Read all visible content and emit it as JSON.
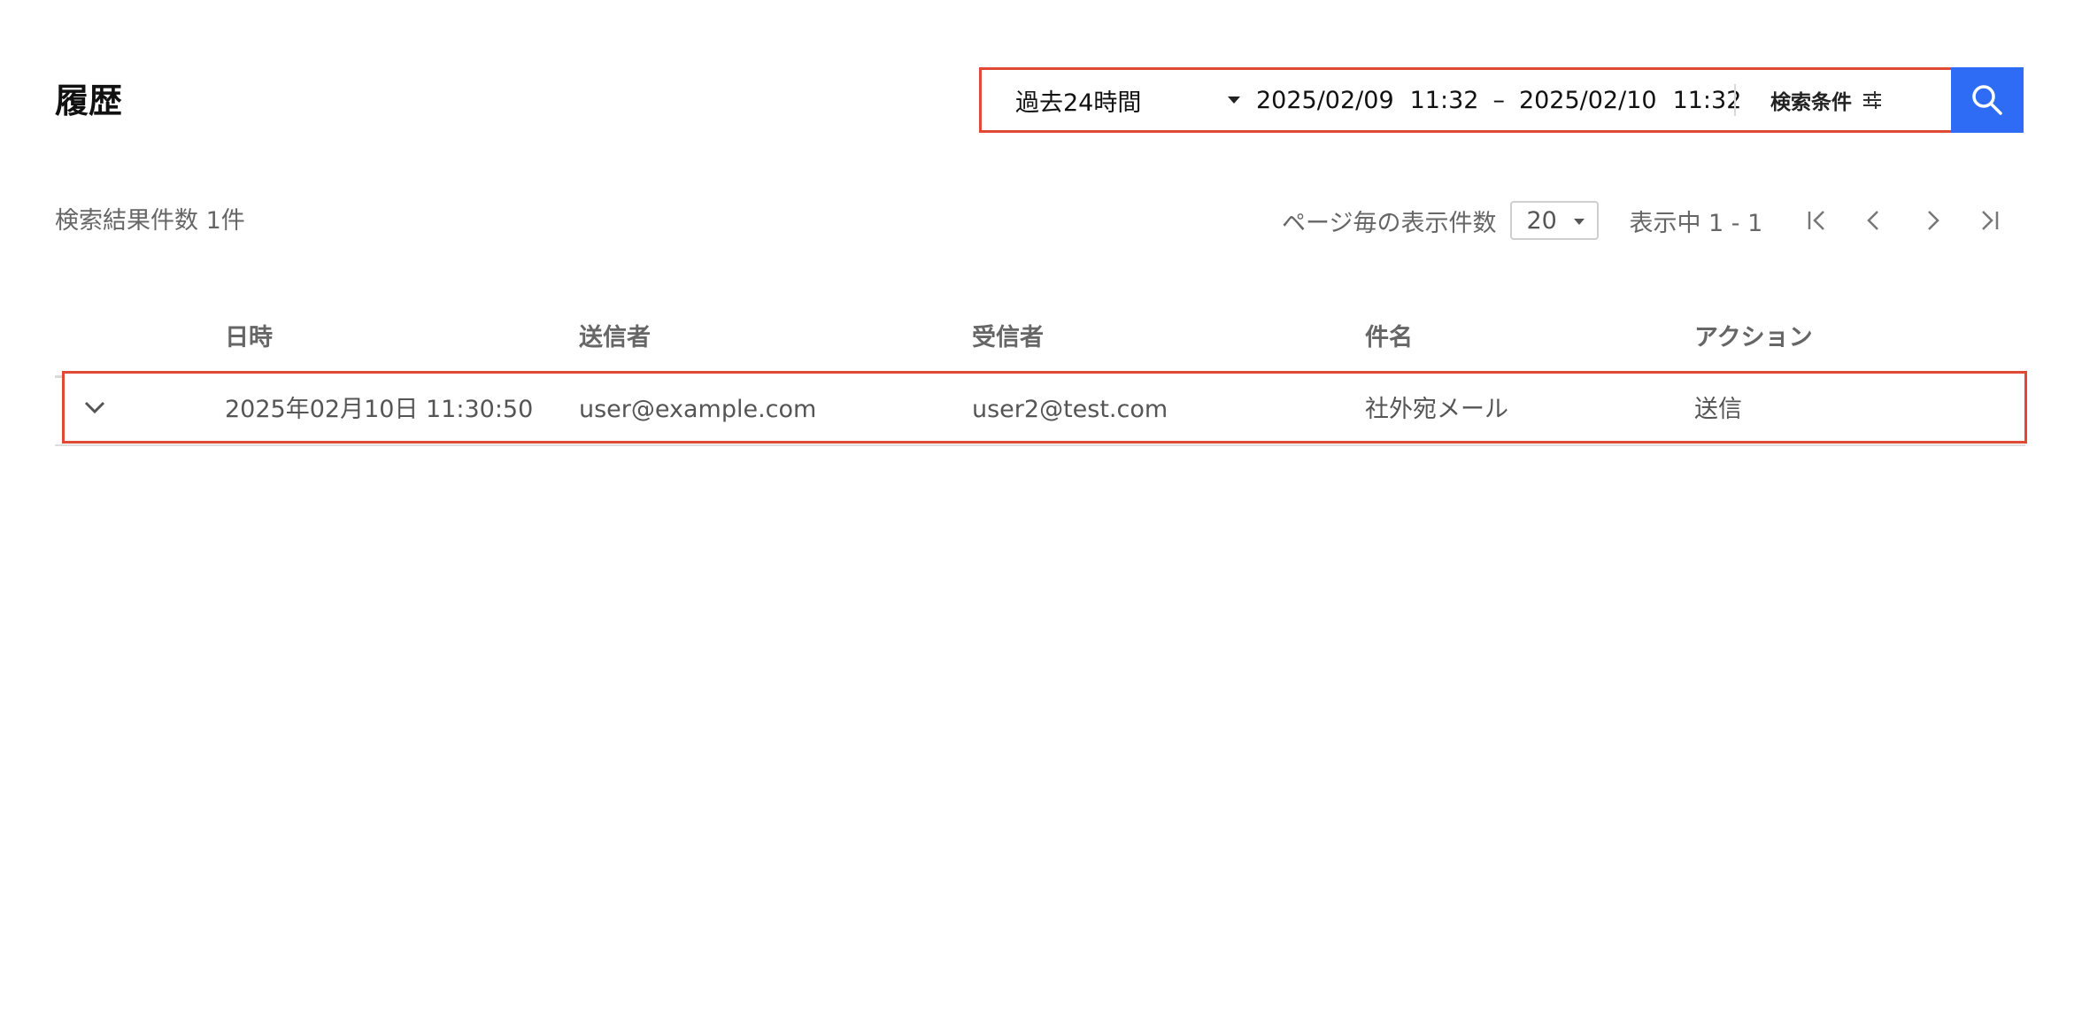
{
  "page": {
    "title": "履歴"
  },
  "search": {
    "range_label": "過去24時間",
    "date_from": "2025/02/09",
    "time_from": "11:32",
    "range_separator": "–",
    "date_to": "2025/02/10",
    "time_to": "11:32",
    "conditions_label": "検索条件"
  },
  "results": {
    "count_label": "検索結果件数 1件",
    "per_page_label": "ページ毎の表示件数",
    "per_page_value": "20",
    "showing_label": "表示中 1 - 1"
  },
  "table": {
    "columns": [
      "日時",
      "送信者",
      "受信者",
      "件名",
      "アクション"
    ],
    "rows": [
      {
        "datetime": "2025年02月10日 11:30:50",
        "sender": "user@example.com",
        "recipient": "user2@test.com",
        "subject": "社外宛メール",
        "action": "送信"
      }
    ]
  },
  "colors": {
    "accent": "#2e6cf6",
    "highlight_border": "#e04a35"
  },
  "icons": {
    "search": "search-icon",
    "conditions": "sliders-icon",
    "expand": "chevron-down-icon",
    "first": "first-page-icon",
    "prev": "chevron-left-icon",
    "next": "chevron-right-icon",
    "last": "last-page-icon"
  }
}
